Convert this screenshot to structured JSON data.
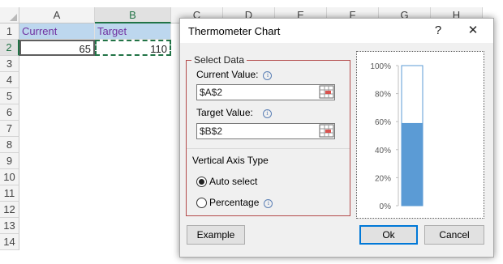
{
  "spreadsheet": {
    "columns": [
      "A",
      "B",
      "C",
      "D",
      "E",
      "F",
      "G",
      "H"
    ],
    "rows": [
      "1",
      "2",
      "3",
      "4",
      "5",
      "6",
      "7",
      "8",
      "9",
      "10",
      "11",
      "12",
      "13",
      "14"
    ],
    "cells": {
      "a1": "Current",
      "b1": "Target",
      "a2": "65",
      "b2": "110"
    }
  },
  "dialog": {
    "title": "Thermometer Chart",
    "help_label": "?",
    "close_label": "✕",
    "select_data_label": "Select Data",
    "current_value_label": "Current Value:",
    "current_value": "$A$2",
    "target_value_label": "Target Value:",
    "target_value": "$B$2",
    "axis_type_label": "Vertical Axis Type",
    "auto_select_label": "Auto select",
    "percentage_label": "Percentage",
    "selected_axis_option": "Auto select",
    "info_glyph": "i",
    "example_label": "Example",
    "ok_label": "Ok",
    "cancel_label": "Cancel"
  },
  "chart_data": {
    "type": "bar",
    "categories": [
      ""
    ],
    "values": [
      0.59
    ],
    "ylim": [
      0,
      1
    ],
    "yticks": [
      "0%",
      "20%",
      "40%",
      "60%",
      "80%",
      "100%"
    ],
    "fill_color": "#5b9bd5"
  },
  "colors": {
    "header_fill": "#bdd7ee",
    "header_text": "#7030a0",
    "excel_green": "#217346",
    "group_border": "#b34a4a"
  }
}
